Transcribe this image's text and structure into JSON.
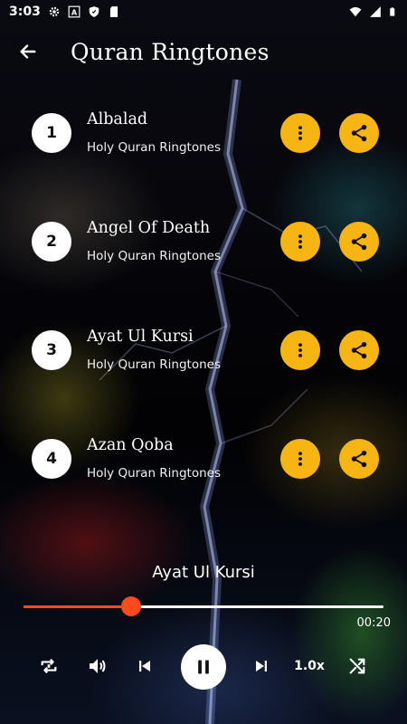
{
  "status_bar": {
    "time": "3:03",
    "icons": [
      "settings-icon",
      "a-icon",
      "shield-icon",
      "sd-card-icon",
      "wifi-icon",
      "signal-icon",
      "battery-icon"
    ]
  },
  "app_bar": {
    "title": "Quran Ringtones",
    "back_icon": "arrow-left-icon"
  },
  "ringtones": [
    {
      "number": "1",
      "title": "Albalad",
      "subtitle": "Holy Quran Ringtones"
    },
    {
      "number": "2",
      "title": "Angel Of Death",
      "subtitle": "Holy Quran Ringtones"
    },
    {
      "number": "3",
      "title": "Ayat Ul Kursi",
      "subtitle": "Holy Quran Ringtones"
    },
    {
      "number": "4",
      "title": "Azan Qoba",
      "subtitle": "Holy Quran Ringtones"
    }
  ],
  "player": {
    "now_playing": "Ayat Ul Kursi",
    "elapsed": "00:20",
    "progress": 0.3,
    "speed": "1.0x",
    "state": "playing"
  },
  "colors": {
    "accent": "#f7b514",
    "seek": "#ff4a1c",
    "number_bg": "#ffffff"
  }
}
